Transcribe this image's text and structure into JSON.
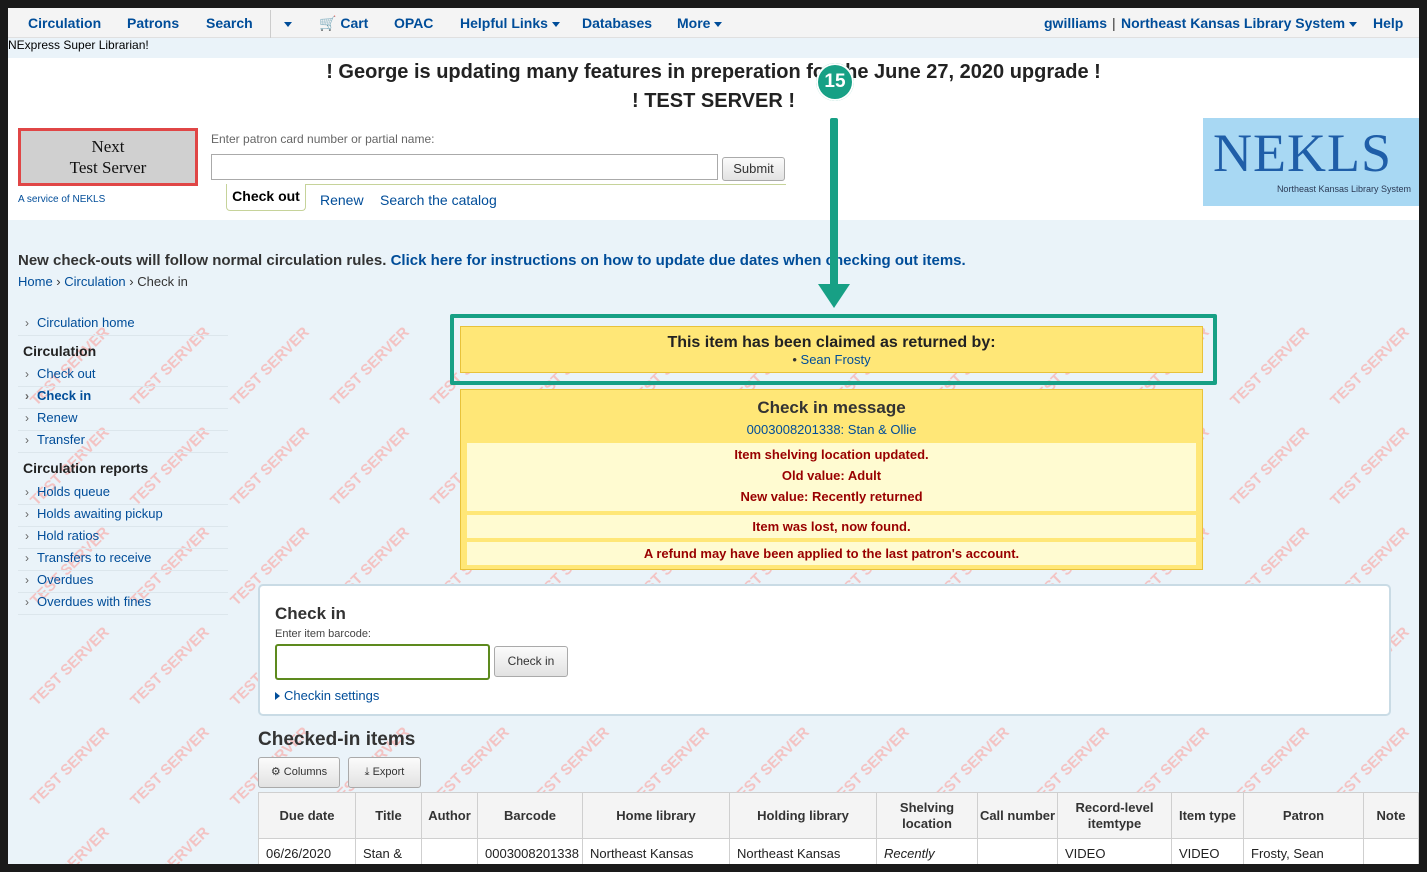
{
  "nav": {
    "items": [
      "Circulation",
      "Patrons",
      "Search",
      "Cart",
      "OPAC",
      "Helpful Links",
      "Databases",
      "More"
    ],
    "user": "gwilliams",
    "branch": "Northeast Kansas Library System",
    "help": "Help"
  },
  "welcome": "NExpress Super Librarian!",
  "announcement": {
    "line1": "! George is updating many features in preperation for the June 27, 2020 upgrade !",
    "line2": "! TEST SERVER !"
  },
  "logo": {
    "line1": "Next",
    "line2": "Test Server",
    "service": "A service of NEKLS"
  },
  "patron_search": {
    "label": "Enter patron card number or partial name:",
    "value": "",
    "submit": "Submit",
    "tabs": [
      "Check out",
      "Renew",
      "Search the catalog"
    ]
  },
  "nekls": {
    "title": "NEKLS",
    "subtitle": "Northeast Kansas Library System"
  },
  "notice": {
    "text": "New check-outs will follow normal circulation rules.",
    "link": "Click here for instructions on how to update due dates when checking out items."
  },
  "breadcrumb": [
    "Home",
    "Circulation",
    "Check in"
  ],
  "sidebar": {
    "home": "Circulation home",
    "section1": "Circulation",
    "items1": [
      "Check out",
      "Check in",
      "Renew",
      "Transfer"
    ],
    "section2": "Circulation reports",
    "items2": [
      "Holds queue",
      "Holds awaiting pickup",
      "Hold ratios",
      "Transfers to receive",
      "Overdues",
      "Overdues with fines"
    ]
  },
  "watermark": "TEST SERVER",
  "claim": {
    "title": "This item has been claimed as returned by:",
    "patron": "Sean Frosty"
  },
  "checkin_message": {
    "title": "Check in message",
    "item": "0003008201338: Stan & Ollie",
    "shelving_updated": "Item shelving location updated.",
    "old_value": "Old value: Adult",
    "new_value": "New value: Recently returned",
    "lost_found": "Item was lost, now found.",
    "refund": "A refund may have been applied to the last patron's account."
  },
  "checkin_form": {
    "title": "Check in",
    "label": "Enter item barcode:",
    "value": "",
    "button": "Check in",
    "settings": "Checkin settings"
  },
  "checked_in": {
    "title": "Checked-in items",
    "columns_btn": "Columns",
    "export_btn": "Export",
    "headers": [
      "Due date",
      "Title",
      "Author",
      "Barcode",
      "Home library",
      "Holding library",
      "Shelving location",
      "Call number",
      "Record-level itemtype",
      "Item type",
      "Patron",
      "Note"
    ],
    "rows": [
      [
        "06/26/2020",
        "Stan &",
        "",
        "0003008201338",
        "Northeast Kansas",
        "Northeast Kansas",
        "Recently",
        "",
        "VIDEO",
        "VIDEO",
        "Frosty, Sean",
        ""
      ]
    ]
  },
  "annotation": {
    "step": "15"
  }
}
